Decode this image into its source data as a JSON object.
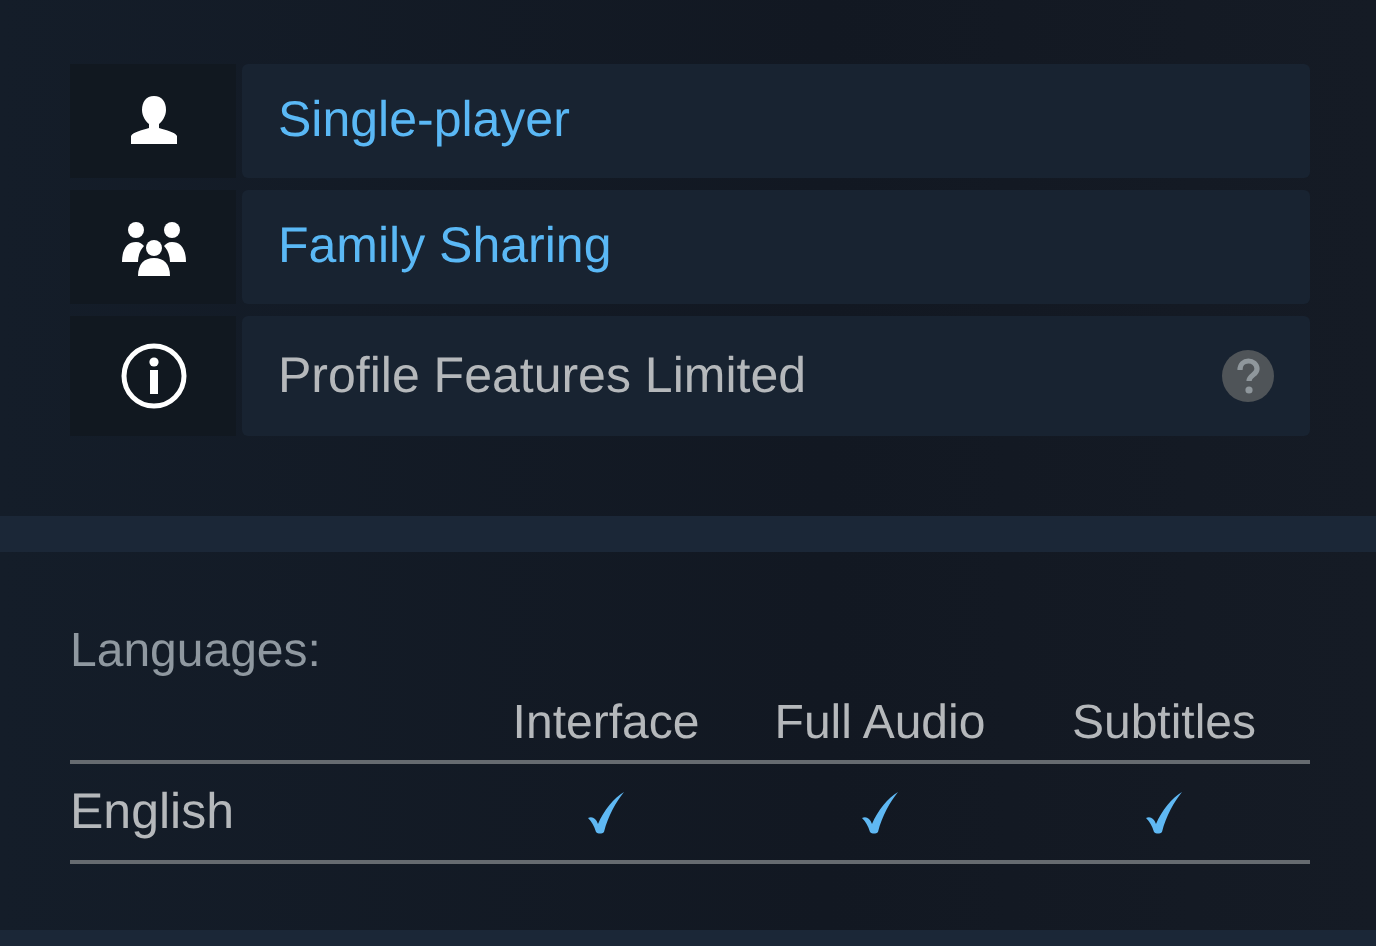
{
  "features": [
    {
      "kind": "single",
      "label": "Single-player"
    },
    {
      "kind": "family",
      "label": "Family Sharing"
    },
    {
      "kind": "limited",
      "label": "Profile Features Limited"
    }
  ],
  "languages": {
    "title": "Languages:",
    "columns": [
      "Interface",
      "Full Audio",
      "Subtitles"
    ],
    "rows": [
      {
        "name": "English",
        "checks": [
          true,
          true,
          true
        ]
      }
    ]
  }
}
